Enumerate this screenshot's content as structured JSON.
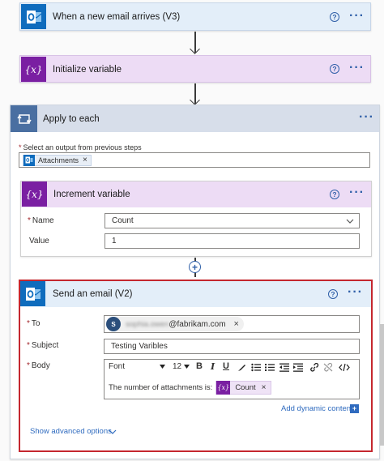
{
  "colors": {
    "outlook_blue": "#0f6cbd",
    "variable_purple": "#7a1fa2",
    "apply_header": "#d7deea",
    "apply_icon_tile": "#4a6fa1",
    "selected_outline": "#c4272f",
    "link_blue": "#2f6bbf"
  },
  "trigger": {
    "title": "When a new email arrives (V3)",
    "icon": "outlook-icon"
  },
  "init_variable": {
    "title": "Initialize variable",
    "icon": "variable-icon",
    "glyph": "{x}"
  },
  "apply_to_each": {
    "title": "Apply to each",
    "icon": "loop-icon",
    "select_label": "Select an output from previous steps",
    "token": "Attachments"
  },
  "increment_variable": {
    "title": "Increment variable",
    "glyph": "{x}",
    "name_label": "Name",
    "name_value": "Count",
    "value_label": "Value",
    "value_value": "1"
  },
  "send_email": {
    "title": "Send an email (V2)",
    "to_label": "To",
    "recipient_initial": "S",
    "recipient_blurred": "sophia.owen",
    "recipient_domain": "@fabrikam.com",
    "subject_label": "Subject",
    "subject_value": "Testing Varibles",
    "body_label": "Body",
    "font_value": "Font",
    "font_size": "12",
    "body_text": "The number of attachments is:",
    "body_token_glyph": "{x}",
    "body_token": "Count",
    "add_dynamic": "Add dynamic content",
    "show_advanced": "Show advanced options"
  },
  "icons": {
    "help": "?",
    "more": "···",
    "close": "×",
    "plus": "+",
    "chevron": "⌄"
  }
}
